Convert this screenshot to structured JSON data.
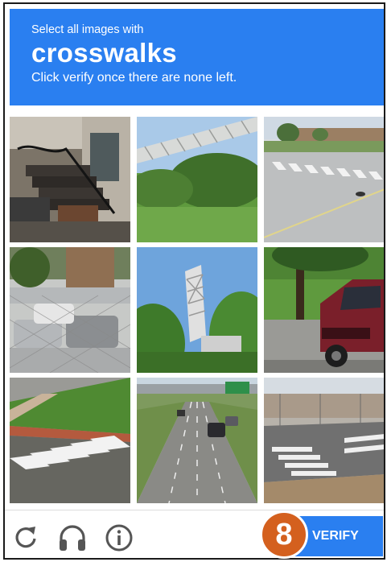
{
  "challenge": {
    "instruction": "Select all images with",
    "target": "crosswalks",
    "hint": "Click verify once there are none left."
  },
  "tiles": [
    {
      "index": 1,
      "scene": "house porch stairs with iron railing"
    },
    {
      "index": 2,
      "scene": "overhead highway sign gantry over grass"
    },
    {
      "index": 3,
      "scene": "parking lot road with striped crosswalk"
    },
    {
      "index": 4,
      "scene": "cars parked behind chain-link fence"
    },
    {
      "index": 5,
      "scene": "sign structure among trees and sky"
    },
    {
      "index": 6,
      "scene": "red suv parked on road by trees"
    },
    {
      "index": 7,
      "scene": "road with zebra crosswalk by grassy hill"
    },
    {
      "index": 8,
      "scene": "highway traffic under overpass"
    },
    {
      "index": 9,
      "scene": "intersection with striped crosswalk"
    }
  ],
  "toolbar": {
    "reload_icon": "reload-icon",
    "audio_icon": "headphones-icon",
    "info_icon": "info-icon"
  },
  "verify_label": "VERIFY",
  "step_badge": "8",
  "colors": {
    "accent": "#2a7ff0",
    "badge": "#d4601e",
    "icon": "#555555"
  }
}
